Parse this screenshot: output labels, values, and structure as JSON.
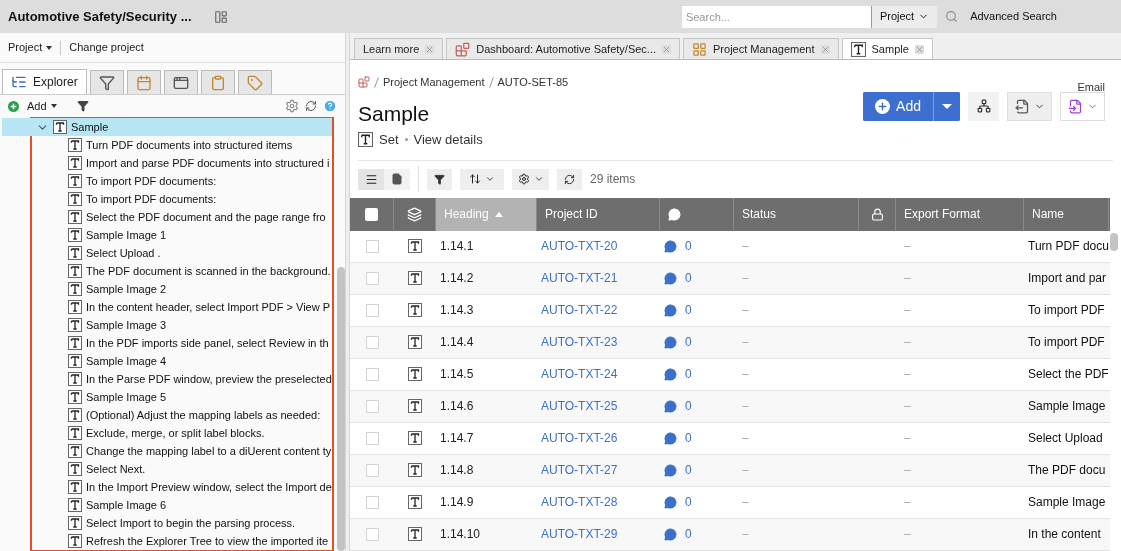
{
  "header": {
    "title": "Automotive Safety/Security ...",
    "search": {
      "placeholder": "Search..."
    },
    "scope": "Project",
    "advanced_search": "Advanced Search"
  },
  "sidebar": {
    "project_menu": "Project",
    "change_project": "Change project",
    "tabs": [
      {
        "kind": "explorer",
        "label": "Explorer",
        "selected": true
      },
      {
        "kind": "filter",
        "selected": false
      },
      {
        "kind": "calendar",
        "selected": false
      },
      {
        "kind": "window",
        "selected": false
      },
      {
        "kind": "clipboard",
        "selected": false
      },
      {
        "kind": "tag",
        "selected": false
      }
    ],
    "add": "Add",
    "tree": [
      {
        "label": "Sample",
        "expanded": true,
        "selected": true,
        "children": [
          {
            "label": "Turn PDF documents into structured items"
          },
          {
            "label": "Import and parse PDF documents into structured i"
          },
          {
            "label": "To import PDF documents:"
          },
          {
            "label": "To import PDF documents:"
          },
          {
            "label": "Select the PDF document and the page range fro"
          },
          {
            "label": "Sample Image 1"
          },
          {
            "label": "Select Upload ."
          },
          {
            "label": "The PDF document is scanned in the background."
          },
          {
            "label": "Sample Image 2"
          },
          {
            "label": "In the content header, select Import PDF > View P"
          },
          {
            "label": "Sample Image 3"
          },
          {
            "label": "In the PDF imports side panel, select Review in th"
          },
          {
            "label": "Sample Image 4"
          },
          {
            "label": "In the Parse PDF window, preview the preselected"
          },
          {
            "label": "Sample Image 5"
          },
          {
            "label": "(Optional) Adjust the mapping labels as needed:"
          },
          {
            "label": "Exclude, merge, or split label blocks."
          },
          {
            "label": "Change the mapping label to a diUerent content ty"
          },
          {
            "label": "Select Next."
          },
          {
            "label": "In the Import Preview window, select the Import de"
          },
          {
            "label": "Sample Image 6"
          },
          {
            "label": "Select Import to begin the parsing process."
          },
          {
            "label": "Refresh the Explorer Tree to view the imported ite"
          }
        ]
      }
    ]
  },
  "tabs": [
    {
      "kind": "text",
      "label": "Learn more",
      "selected": false
    },
    {
      "kind": "dashboard",
      "label": "Dashboard: Automotive Safety/Sec...",
      "selected": false
    },
    {
      "kind": "grid",
      "label": "Project Management",
      "selected": false
    },
    {
      "kind": "set",
      "label": "Sample",
      "selected": true
    }
  ],
  "breadcrumb": [
    "Project Management",
    "AUTO-SET-85"
  ],
  "email": "Email",
  "title": "Sample",
  "subtitle": {
    "type": "Set",
    "link": "View details"
  },
  "add_button": "Add",
  "item_count": "29 items",
  "table": {
    "columns": [
      {
        "kind": "checkbox",
        "checked": false
      },
      {
        "kind": "type"
      },
      {
        "kind": "text",
        "label": "Heading",
        "selected": true
      },
      {
        "kind": "text",
        "label": "Project ID",
        "selected": false
      },
      {
        "kind": "comment"
      },
      {
        "kind": "text",
        "label": "Status",
        "selected": false
      },
      {
        "kind": "lock"
      },
      {
        "kind": "text",
        "label": "Export Format",
        "selected": false
      },
      {
        "kind": "text",
        "label": "Name",
        "selected": false
      }
    ],
    "rows": [
      {
        "checked": false,
        "heading": "1.14.1",
        "project_id": "AUTO-TXT-20",
        "comments": "0",
        "status": "–",
        "export_format": "–",
        "name": "Turn PDF docu"
      },
      {
        "checked": false,
        "heading": "1.14.2",
        "project_id": "AUTO-TXT-21",
        "comments": "0",
        "status": "–",
        "export_format": "–",
        "name": "Import and par"
      },
      {
        "checked": false,
        "heading": "1.14.3",
        "project_id": "AUTO-TXT-22",
        "comments": "0",
        "status": "–",
        "export_format": "–",
        "name": "To import PDF"
      },
      {
        "checked": false,
        "heading": "1.14.4",
        "project_id": "AUTO-TXT-23",
        "comments": "0",
        "status": "–",
        "export_format": "–",
        "name": "To import PDF"
      },
      {
        "checked": false,
        "heading": "1.14.5",
        "project_id": "AUTO-TXT-24",
        "comments": "0",
        "status": "–",
        "export_format": "–",
        "name": "Select the PDF"
      },
      {
        "checked": false,
        "heading": "1.14.6",
        "project_id": "AUTO-TXT-25",
        "comments": "0",
        "status": "–",
        "export_format": "–",
        "name": "Sample Image"
      },
      {
        "checked": false,
        "heading": "1.14.7",
        "project_id": "AUTO-TXT-26",
        "comments": "0",
        "status": "–",
        "export_format": "–",
        "name": "Select Upload"
      },
      {
        "checked": false,
        "heading": "1.14.8",
        "project_id": "AUTO-TXT-27",
        "comments": "0",
        "status": "–",
        "export_format": "–",
        "name": "The PDF docu"
      },
      {
        "checked": false,
        "heading": "1.14.9",
        "project_id": "AUTO-TXT-28",
        "comments": "0",
        "status": "–",
        "export_format": "–",
        "name": "Sample Image"
      },
      {
        "checked": false,
        "heading": "1.14.10",
        "project_id": "AUTO-TXT-29",
        "comments": "0",
        "status": "–",
        "export_format": "–",
        "name": "In the content"
      }
    ]
  }
}
